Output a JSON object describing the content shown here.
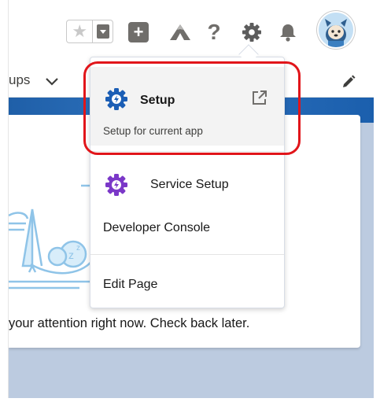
{
  "header": {
    "favorites_star": "★",
    "new_button": "+",
    "help": "?"
  },
  "nav": {
    "groups_label": "ups"
  },
  "setup_menu": {
    "setup": {
      "title": "Setup",
      "subtitle": "Setup for current app"
    },
    "items": [
      {
        "label": "Service Setup"
      },
      {
        "label": "Developer Console"
      },
      {
        "label": "Edit Page"
      }
    ]
  },
  "content": {
    "empty_message": "your attention right now. Check back later."
  },
  "colors": {
    "setup_gear": "#1b5eb5",
    "service_gear": "#7b38c8",
    "highlight": "#e1151a",
    "icon_gray": "#706e6b"
  }
}
